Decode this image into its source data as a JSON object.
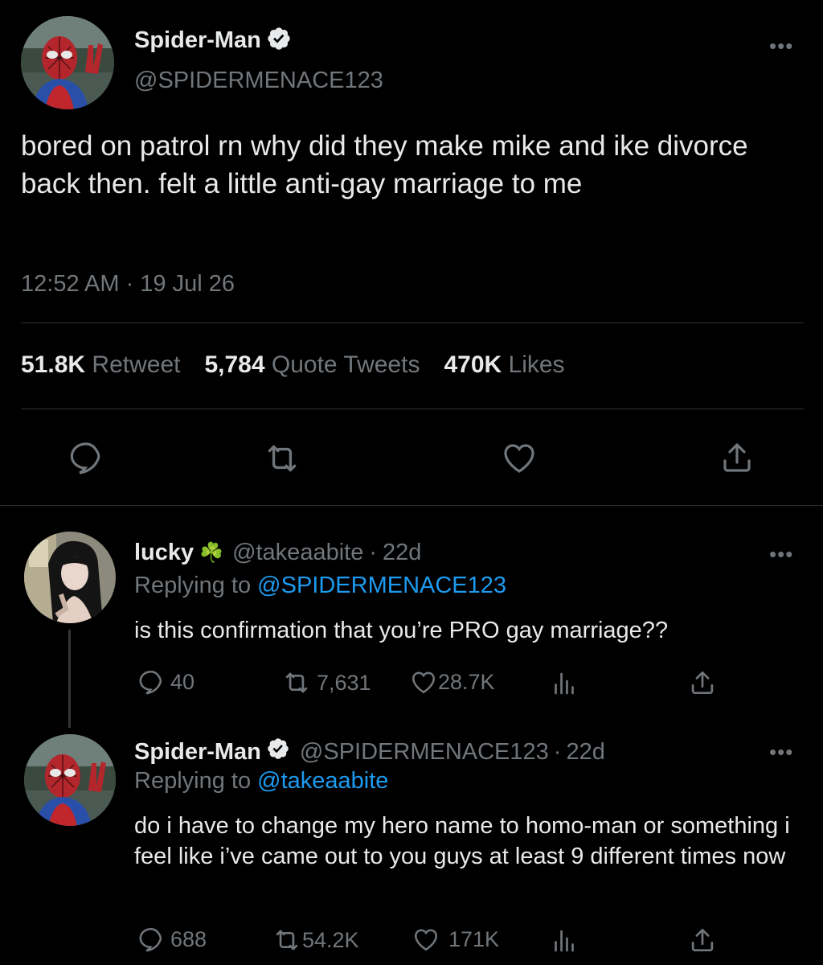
{
  "main_tweet": {
    "display_name": "Spider-Man",
    "handle": "@SPIDERMENACE123",
    "text": "bored on patrol rn why did they make mike and ike divorce back then. felt a little anti-gay marriage to me",
    "timestamp": "12:52 AM · 19 Jul 26",
    "stats": {
      "retweets_count": "51.8K",
      "retweets_label": "Retweet",
      "quotes_count": "5,784",
      "quotes_label": "Quote Tweets",
      "likes_count": "470K",
      "likes_label": "Likes"
    },
    "more_label": "•••"
  },
  "replies": [
    {
      "display_name": "lucky",
      "emoji": "☘️",
      "handle": "@takeaabite",
      "separator": "·",
      "age": "22d",
      "replying_prefix": "Replying to",
      "replying_to": "@SPIDERMENACE123",
      "text": "is this confirmation that you’re PRO gay marriage??",
      "replies": "40",
      "retweets": "7,631",
      "likes": "28.7K",
      "more_label": "•••"
    },
    {
      "display_name": "Spider-Man",
      "handle": "@SPIDERMENACE123",
      "separator": "·",
      "age": "22d",
      "replying_prefix": "Replying to",
      "replying_to": "@takeaabite",
      "text": "do i have to change my hero name to homo-man or something i feel like i’ve came out to you guys at least 9 different times now",
      "replies": "688",
      "retweets": "54.2K",
      "likes": "171K",
      "more_label": "•••"
    }
  ],
  "colors": {
    "background": "#000000",
    "text": "#e7e9ea",
    "muted": "#71767b",
    "link": "#1d9bf0",
    "divider": "#2f3336"
  },
  "icons": [
    "verified-badge-icon",
    "more-icon",
    "reply-icon",
    "retweet-icon",
    "like-icon",
    "share-icon",
    "views-icon"
  ]
}
